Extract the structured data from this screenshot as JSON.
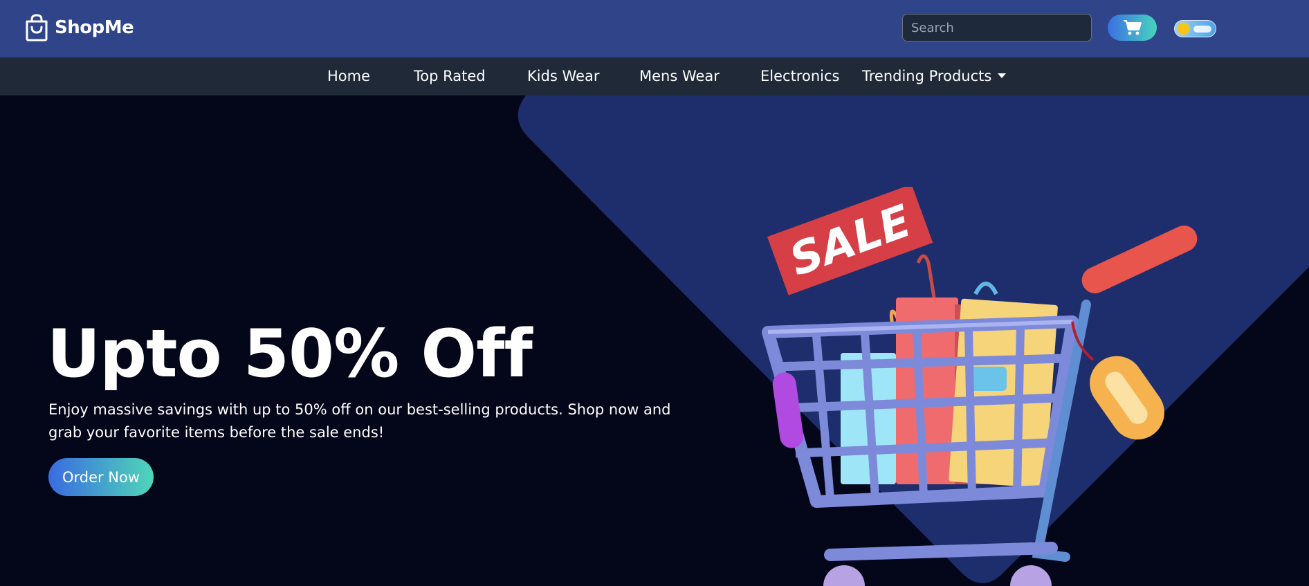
{
  "brand": {
    "name": "ShopMe",
    "icon": "shopping-bag-icon"
  },
  "header": {
    "search_placeholder": "Search",
    "cart_icon": "shopping-cart-icon",
    "theme_toggle": "day-night-toggle"
  },
  "nav": {
    "items": [
      {
        "label": "Home"
      },
      {
        "label": "Top Rated"
      },
      {
        "label": "Kids Wear"
      },
      {
        "label": "Mens Wear"
      },
      {
        "label": "Electronics"
      },
      {
        "label": "Trending Products",
        "icon": "caret-down-icon"
      }
    ]
  },
  "hero": {
    "title": "Upto 50% Off",
    "description": "Enjoy massive savings with up to 50% off on our best-selling products. Shop now and grab your favorite items before the sale ends!",
    "cta_label": "Order Now",
    "sale_tag": "SALE"
  },
  "colors": {
    "topbar": "#2f4489",
    "navbar": "#1f2937",
    "background": "#04061a",
    "hero_shape": "#1e2d6b",
    "gradient_start": "#3b6fe3",
    "gradient_end": "#47d4bd"
  }
}
